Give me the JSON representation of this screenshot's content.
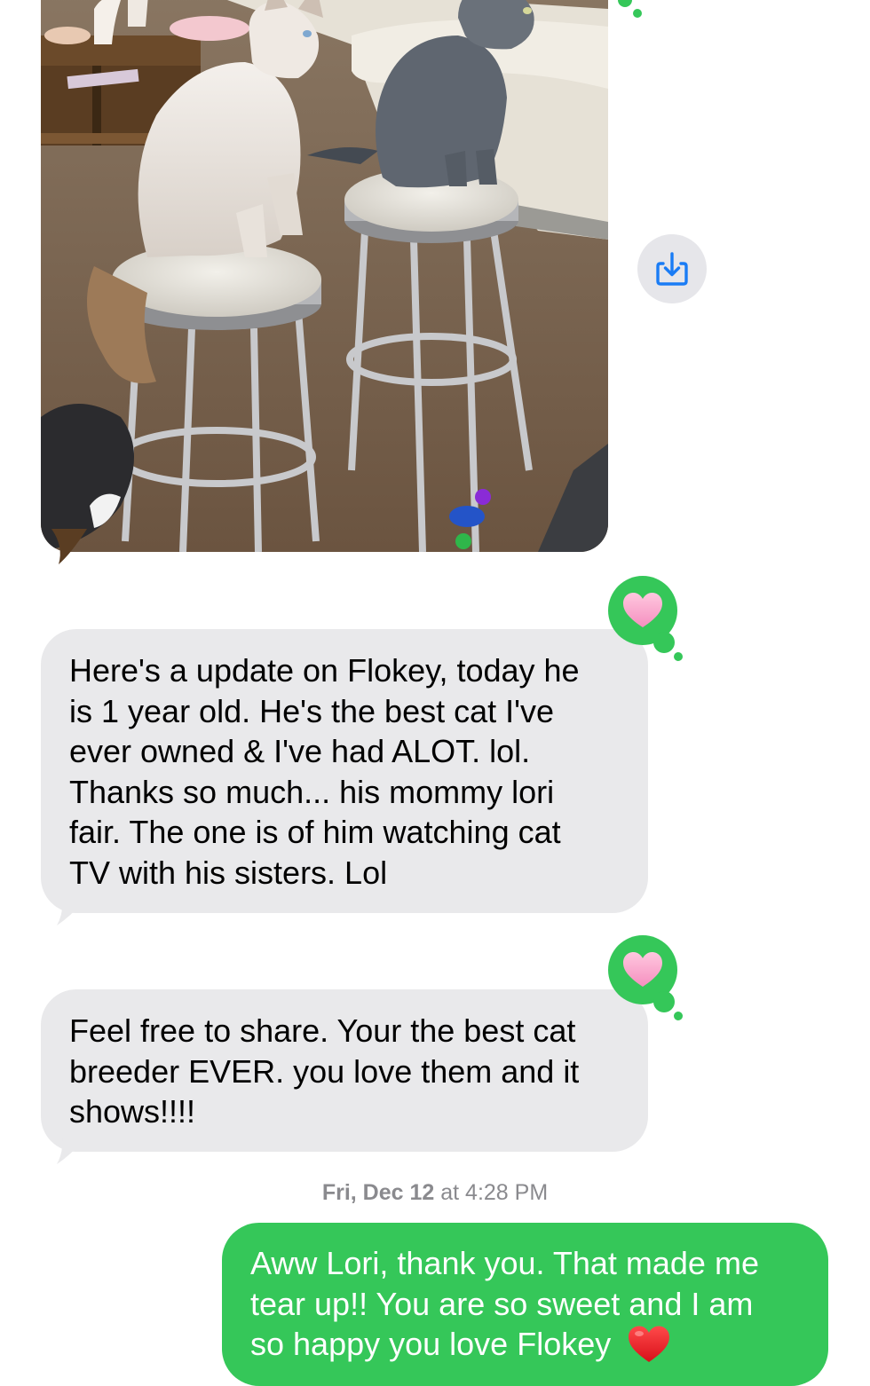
{
  "photo": {
    "alt": "Flokey"
  },
  "save_button": {
    "icon": "download-icon"
  },
  "messages": [
    {
      "direction": "incoming",
      "reaction": "heart",
      "text": "Here's a update on Flokey, today he\nis 1 year old. He's the best cat I've\never owned & I've had ALOT. lol.\nThanks so much... his mommy lori\nfair. The one is of him watching cat\nTV with his sisters. Lol"
    },
    {
      "direction": "incoming",
      "reaction": "heart",
      "text": "Feel free to share. Your the best cat\nbreeder EVER. you love them and it\nshows!!!!"
    }
  ],
  "timestamp": {
    "day": "Fri, Dec 12",
    "time": " at 4:28 PM"
  },
  "reply": {
    "direction": "outgoing",
    "text": "Aww Lori, thank you. That made me\ntear up!! You are so sweet and I am\nso happy you love Flokey",
    "emoji": "red-heart"
  },
  "colors": {
    "incoming_bubble": "#e9e9eb",
    "outgoing_bubble": "#35c759",
    "reaction_badge": "#35c759",
    "timestamp": "#8a8a8e",
    "icon_blue": "#1a7cf5"
  }
}
